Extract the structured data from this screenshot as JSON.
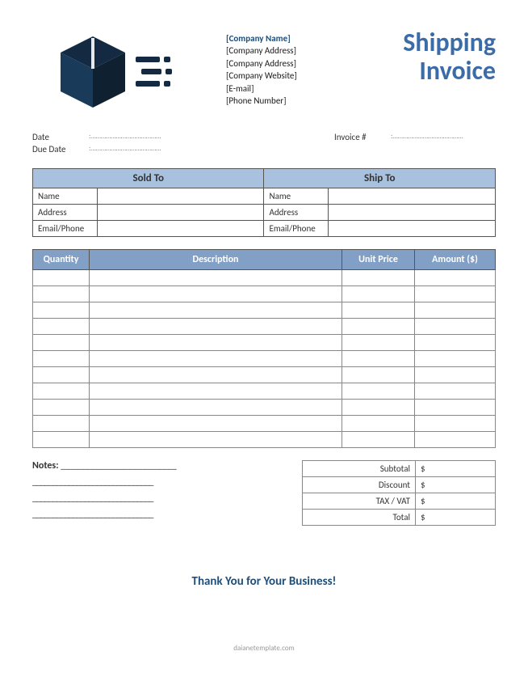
{
  "logo_name": "shipping-box",
  "company": {
    "name": "[Company Name]",
    "address1": "[Company Address]",
    "address2": "[Company Address]",
    "website": "[Company Website]",
    "email": "[E-mail]",
    "phone": "[Phone Number]"
  },
  "title_line1": "Shipping",
  "title_line2": "Invoice",
  "meta": {
    "date_label": "Date",
    "date_value": ":……………………………………",
    "due_date_label": "Due Date",
    "due_date_value": ":……………………………………",
    "invoice_label": "Invoice #",
    "invoice_value": ":……………………………………"
  },
  "parties": {
    "sold_to": "Sold To",
    "ship_to": "Ship To",
    "name": "Name",
    "address": "Address",
    "email_phone": "Email/Phone"
  },
  "items_headers": {
    "quantity": "Quantity",
    "description": "Description",
    "unit_price": "Unit Price",
    "amount": "Amount ($)"
  },
  "notes": {
    "label": "Notes:",
    "line_placeholder": "________________________",
    "line_placeholder_long": "______________________________"
  },
  "totals": {
    "subtotal_label": "Subtotal",
    "subtotal_value": "$",
    "discount_label": "Discount",
    "discount_value": "$",
    "tax_label": "TAX / VAT",
    "tax_value": "$",
    "total_label": "Total",
    "total_value": "$"
  },
  "thanks": "Thank You for Your Business!",
  "watermark": "daianetemplate.com"
}
